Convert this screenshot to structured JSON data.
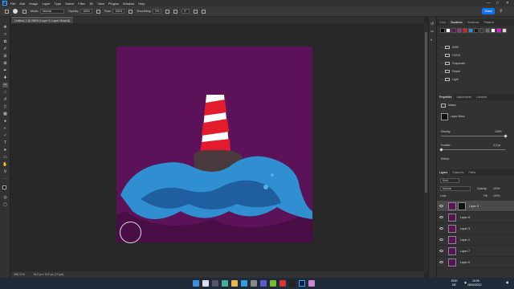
{
  "menu": {
    "items": [
      "File",
      "Edit",
      "Image",
      "Layer",
      "Type",
      "Select",
      "Filter",
      "3D",
      "View",
      "Plugins",
      "Window",
      "Help"
    ]
  },
  "options": {
    "mode_label": "Mode:",
    "mode_value": "Normal",
    "opacity_label": "Opacity:",
    "opacity_value": "100%",
    "flow_label": "Flow:",
    "flow_value": "100%",
    "smoothing_label": "Smoothing:",
    "smoothing_value": "0%",
    "angle_value": "0°",
    "share_label": "Share"
  },
  "document": {
    "tab_title": "Untitled-1 @ 285% (Layer 9, Layer Mask/8)",
    "zoom": "285,71%",
    "size": "512 px x 512 px (72 ppi)",
    "canvas_color": "#5c1259"
  },
  "swatches_panel": {
    "tabs": [
      "Color",
      "Swatches",
      "Gradients",
      "Patterns"
    ],
    "active_tab": "Swatches",
    "colors": [
      "#000000",
      "#ffffff",
      "#5c1259",
      "#8a3a85",
      "#e21b2d",
      "#2f8fd0",
      "#1a1a1a",
      "#3a3a3a",
      "#6a6a6a",
      "#ffffff",
      "#ff00ff",
      "#d9d9d9"
    ],
    "folders": [
      "RGB",
      "CMYK",
      "Grayscale",
      "Pastel",
      "Light"
    ]
  },
  "properties_panel": {
    "tabs": [
      "Properties",
      "Adjustments",
      "Libraries"
    ],
    "active_tab": "Properties",
    "masks_label": "Masks",
    "layer_mask_label": "Layer Mask",
    "density_label": "Density:",
    "density_value": "100%",
    "feather_label": "Feather:",
    "feather_value": "0,0 px",
    "density_level_pct": 100,
    "feather_level_pct": 0,
    "refine_label": "Refine:"
  },
  "layers_panel": {
    "tabs": [
      "Layers",
      "Channels",
      "Paths"
    ],
    "active_tab": "Layers",
    "kind_label": "Kind",
    "blend_mode": "Normal",
    "opacity_label": "Opacity:",
    "opacity_value": "100%",
    "lock_label": "Lock:",
    "fill_label": "Fill:",
    "fill_value": "100%",
    "layers": [
      {
        "name": "Layer 9",
        "selected": true
      },
      {
        "name": "Layer 8",
        "selected": false
      },
      {
        "name": "Layer 3",
        "selected": false
      },
      {
        "name": "Layer 2",
        "selected": false
      },
      {
        "name": "Layer 7",
        "selected": false
      },
      {
        "name": "Layer 6",
        "selected": false
      }
    ]
  },
  "taskbar": {
    "lang_1": "ENG",
    "lang_2": "DE",
    "time": "15:05",
    "date": "18/04/2022"
  }
}
